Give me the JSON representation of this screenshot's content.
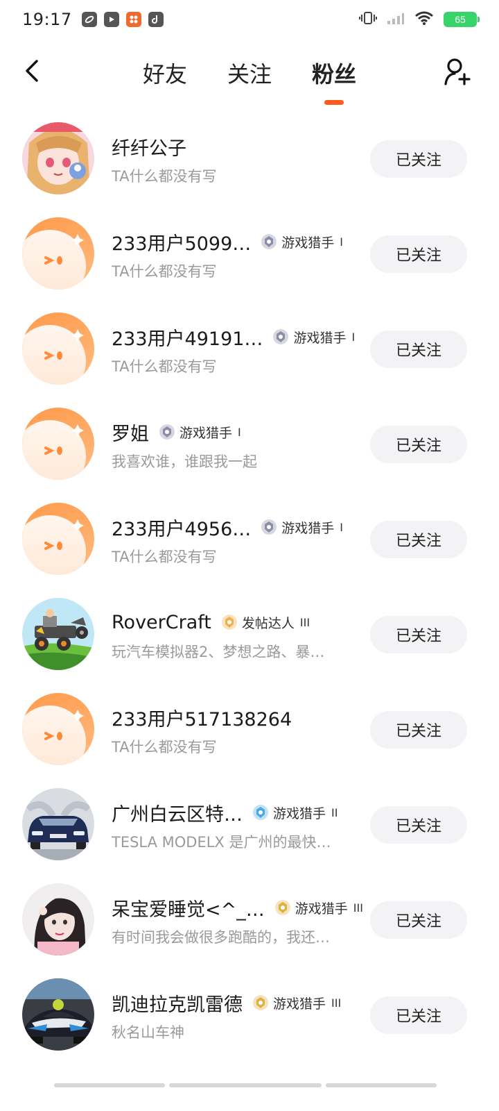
{
  "status_bar": {
    "time": "19:17",
    "battery": "65",
    "app_icons": [
      "app-icon-1",
      "app-icon-2",
      "app-icon-3",
      "app-icon-4"
    ]
  },
  "nav": {
    "tabs": [
      {
        "label": "好友",
        "active": false
      },
      {
        "label": "关注",
        "active": false
      },
      {
        "label": "粉丝",
        "active": true
      }
    ],
    "accent_color": "#ff5a1f"
  },
  "follow_label": "已关注",
  "users": [
    {
      "name": "纤纤公子",
      "badge": "",
      "level": "",
      "bio": "TA什么都没有写",
      "avatar": "anime-girl-avatar",
      "badge_color": ""
    },
    {
      "name": "233用户5099…",
      "badge": "游戏猎手",
      "level": "I",
      "bio": "TA什么都没有写",
      "avatar": "default-avatar",
      "badge_color": "#8c8ca8"
    },
    {
      "name": "233用户49191…",
      "badge": "游戏猎手",
      "level": "I",
      "bio": "TA什么都没有写",
      "avatar": "default-avatar",
      "badge_color": "#8c8ca8"
    },
    {
      "name": "罗姐",
      "badge": "游戏猎手",
      "level": "I",
      "bio": "我喜欢谁，谁跟我一起",
      "avatar": "default-avatar",
      "badge_color": "#8c8ca8"
    },
    {
      "name": "233用户4956…",
      "badge": "游戏猎手",
      "level": "I",
      "bio": "TA什么都没有写",
      "avatar": "default-avatar",
      "badge_color": "#8c8ca8"
    },
    {
      "name": "RoverCraft",
      "badge": "发帖达人",
      "level": "III",
      "bio": "玩汽车模拟器2、梦想之路、暴…",
      "avatar": "rover-avatar",
      "badge_color": "#f0b04a"
    },
    {
      "name": "233用户517138264",
      "badge": "",
      "level": "",
      "bio": "TA什么都没有写",
      "avatar": "default-avatar",
      "badge_color": ""
    },
    {
      "name": "广州白云区特…",
      "badge": "游戏猎手",
      "level": "II",
      "bio": "TESLA MODELX 是广州的最快…",
      "avatar": "tesla-avatar",
      "badge_color": "#4aa8e0"
    },
    {
      "name": "呆宝爱睡觉<^_…",
      "badge": "游戏猎手",
      "level": "III",
      "bio": "有时间我会做很多跑酷的，我还…",
      "avatar": "girl-photo-avatar",
      "badge_color": "#e0b040"
    },
    {
      "name": "凯迪拉克凯雷德",
      "badge": "游戏猎手",
      "level": "III",
      "bio": "秋名山车神",
      "avatar": "racecar-avatar",
      "badge_color": "#e0b040"
    }
  ]
}
